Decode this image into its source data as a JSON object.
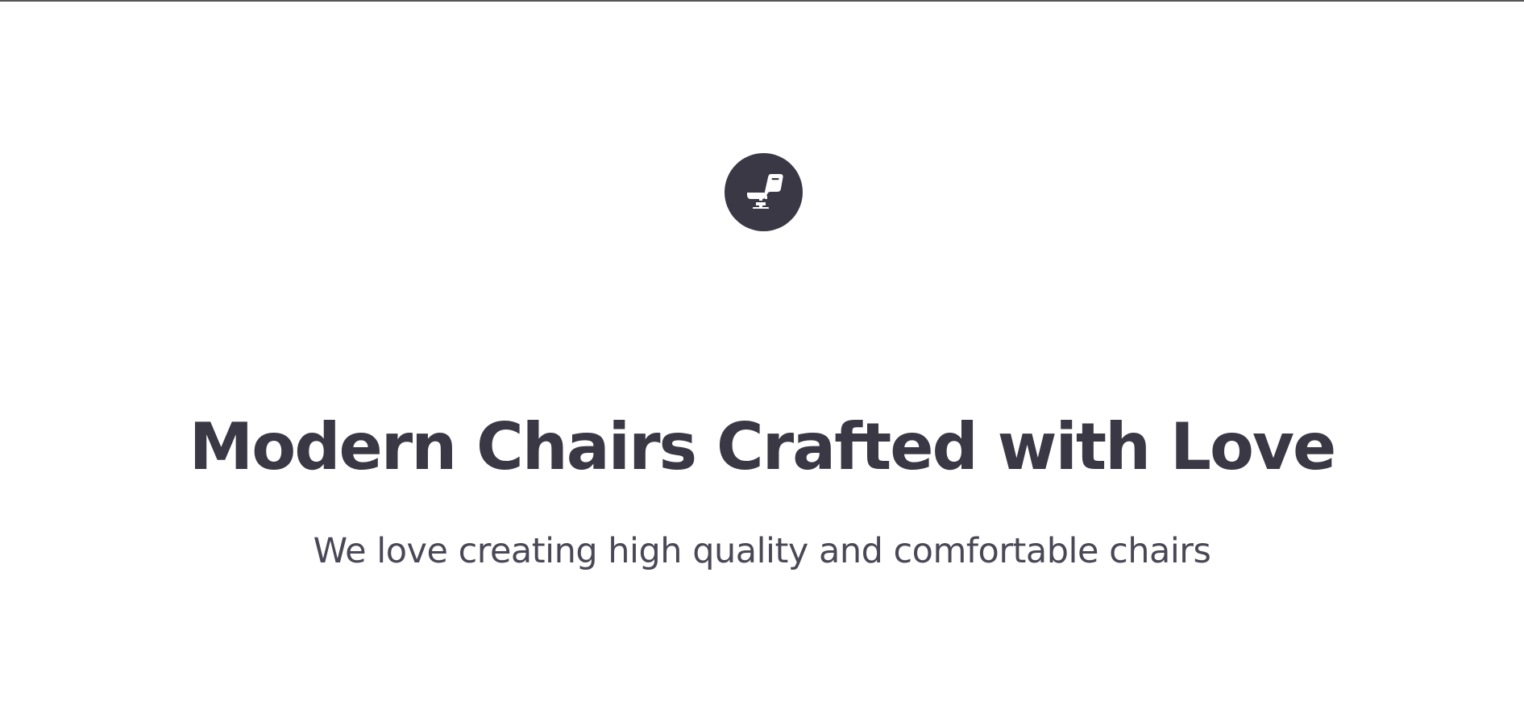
{
  "brand": {
    "logo_icon": "chair-icon",
    "color": "#3a3844"
  },
  "hero": {
    "title": "Modern Chairs Crafted with Love",
    "subtitle": "We love creating high quality and comfortable chairs"
  }
}
